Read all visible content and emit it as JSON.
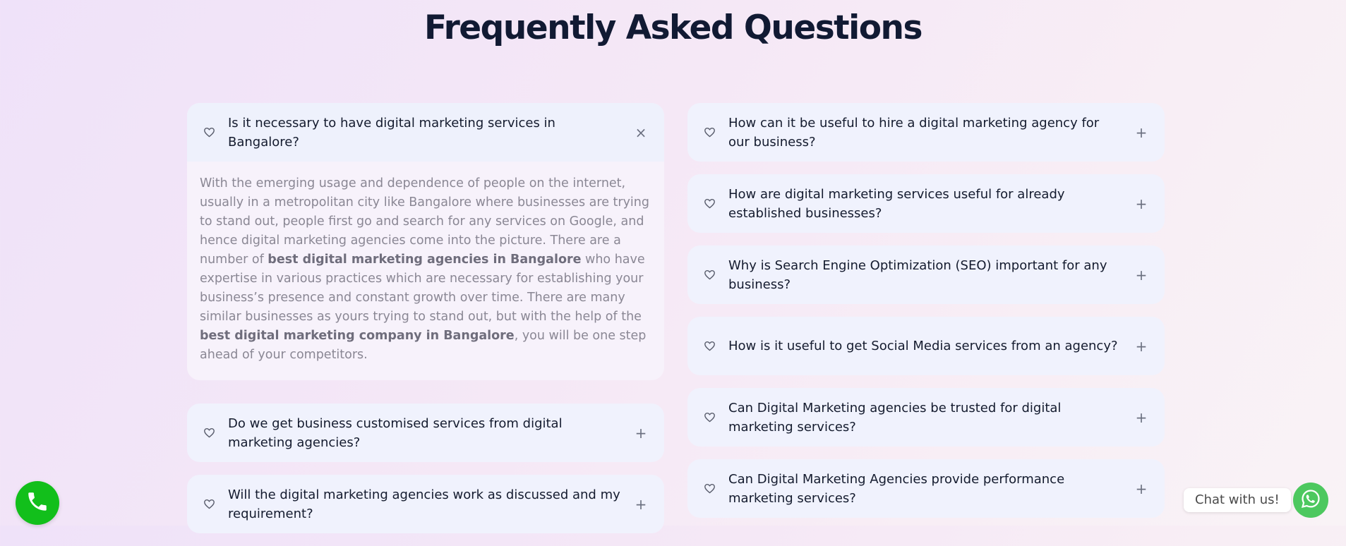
{
  "title": "Frequently Asked Questions",
  "left_items": [
    {
      "question": "Is it necessary to have digital marketing services in Bangalore?",
      "toggle": "×",
      "answer": {
        "p1": "With the emerging usage and dependence of people on the internet, usually in a metropolitan city like Bangalore where businesses are trying to stand out, people first go and search for any services on Google, and hence digital marketing agencies come into the picture. There are a number of ",
        "b1": "best digital marketing agencies in Bangalore",
        "p2": " who have expertise in various practices which are necessary for establishing your business’s presence and constant growth over time. There are many similar businesses as yours trying to stand out, but with the help of the ",
        "b2": "best digital marketing company in Bangalore",
        "p3": ", you will be one step ahead of your competitors."
      }
    },
    {
      "question": "Do we get business customised services from digital marketing agencies?",
      "toggle": "+"
    },
    {
      "question": "Will the digital marketing agencies work as discussed and my requirement?",
      "toggle": "+"
    }
  ],
  "right_items": [
    {
      "question": "How can it be useful to hire a digital marketing agency for our business?",
      "toggle": "+"
    },
    {
      "question": "How are digital marketing services useful for already established businesses?",
      "toggle": "+"
    },
    {
      "question": "Why is Search Engine Optimization (SEO) important for any business?",
      "toggle": "+"
    },
    {
      "question": "How is it useful to get Social Media services from an agency?",
      "toggle": "+"
    },
    {
      "question": "Can Digital Marketing agencies be trusted for digital marketing services?",
      "toggle": "+"
    },
    {
      "question": "Can Digital Marketing Agencies provide performance marketing services?",
      "toggle": "+"
    }
  ],
  "chat": {
    "label": "Chat with us!"
  },
  "icons": {
    "faq": "heart-icon",
    "call": "phone-icon",
    "chat": "whatsapp-icon"
  },
  "colors": {
    "call": "#12bf1b",
    "whatsapp": "#4dc85f",
    "title": "#111a33"
  }
}
